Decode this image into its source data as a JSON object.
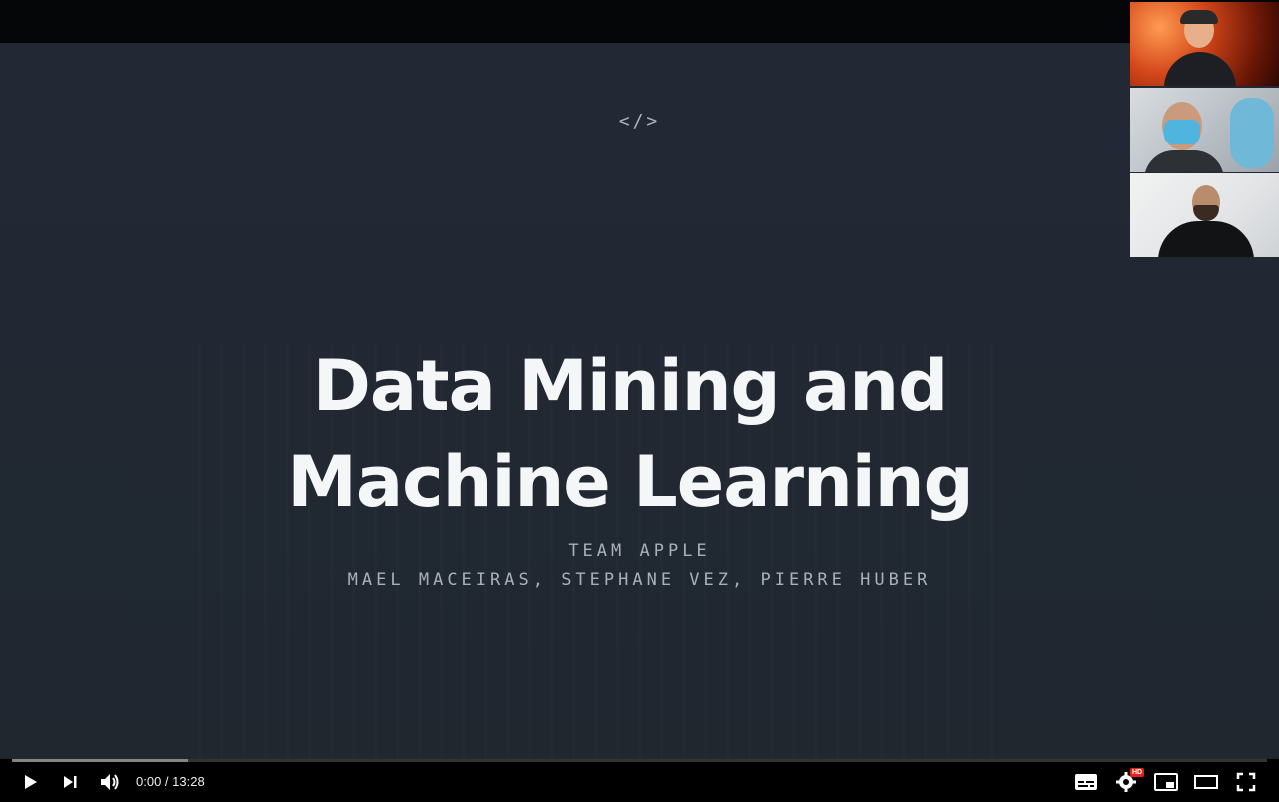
{
  "slide": {
    "icon_text": "</>",
    "title": "Data Mining and Machine Learning",
    "subtitle": "TEAM APPLE",
    "authors": "MAEL MACEIRAS, STEPHANE VEZ, PIERRE HUBER"
  },
  "webcams": [
    {
      "icon": "webcam-video-icon"
    },
    {
      "icon": "webcam-video-icon"
    },
    {
      "icon": "webcam-video-icon"
    }
  ],
  "player": {
    "current_time": "0:00",
    "separator": " / ",
    "duration": "13:28",
    "played_fraction": 0.0,
    "buffered_fraction": 0.14,
    "hd_badge": "HD",
    "accent_color": "#e62117",
    "icons": {
      "play": "play-icon",
      "next": "next-icon",
      "volume": "volume-icon",
      "subtitles": "subtitles-icon",
      "settings": "settings-icon",
      "miniplayer": "miniplayer-icon",
      "theater": "theater-icon",
      "fullscreen": "fullscreen-icon"
    }
  }
}
